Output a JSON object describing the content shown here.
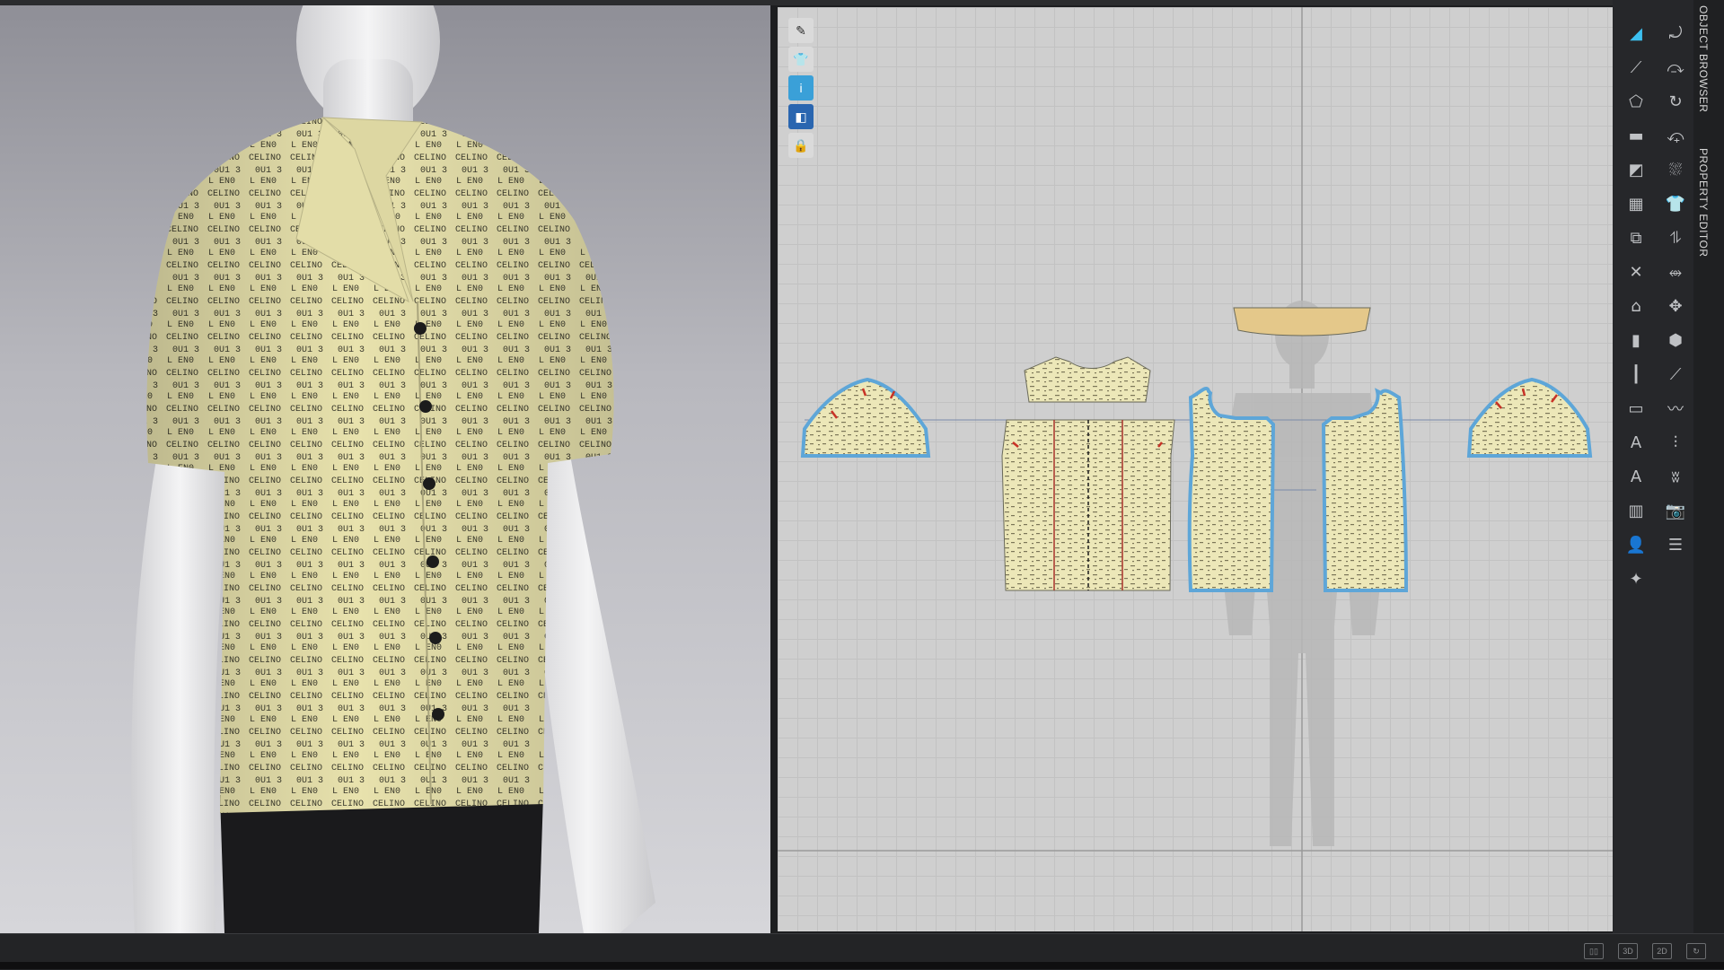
{
  "app": {
    "accent": "#3cc0f0",
    "fabric_color": "#e8e2ad",
    "print_text": "CELINO"
  },
  "toolbox_2d": [
    {
      "name": "edit-pattern-icon",
      "glyph": "✎",
      "state": "normal"
    },
    {
      "name": "shirt-view-icon",
      "glyph": "👕",
      "state": "normal"
    },
    {
      "name": "info-icon",
      "glyph": "i",
      "state": "active"
    },
    {
      "name": "fabric-icon",
      "glyph": "◧",
      "state": "blue"
    },
    {
      "name": "lock-garment-icon",
      "glyph": "🔒",
      "state": "normal"
    }
  ],
  "right_toolbar": [
    {
      "name": "select-move-icon",
      "glyph": "◢",
      "selected": true
    },
    {
      "name": "transform-pattern-icon",
      "glyph": "⤾"
    },
    {
      "name": "edit-point-icon",
      "glyph": "⟋"
    },
    {
      "name": "edit-curvature-icon",
      "glyph": "⤼"
    },
    {
      "name": "polygon-icon",
      "glyph": "⬠"
    },
    {
      "name": "rotate-icon",
      "glyph": "↻"
    },
    {
      "name": "rectangle-icon",
      "glyph": "▬"
    },
    {
      "name": "sewing-icon",
      "glyph": "⤽"
    },
    {
      "name": "internal-shape-icon",
      "glyph": "◩"
    },
    {
      "name": "fold-arrangement-icon",
      "glyph": "⛆"
    },
    {
      "name": "texture-icon",
      "glyph": "▦"
    },
    {
      "name": "shirt-icon",
      "glyph": "👕"
    },
    {
      "name": "create-pattern-icon",
      "glyph": "⧉"
    },
    {
      "name": "segment-sewing-icon",
      "glyph": "⥮"
    },
    {
      "name": "cut-icon",
      "glyph": "✕"
    },
    {
      "name": "multi-sewing-icon",
      "glyph": "⥈"
    },
    {
      "name": "dart-icon",
      "glyph": "⌂"
    },
    {
      "name": "avatar-pin-icon",
      "glyph": "✥"
    },
    {
      "name": "pleat-icon",
      "glyph": "▮"
    },
    {
      "name": "button-icon",
      "glyph": "⬢"
    },
    {
      "name": "seamline-icon",
      "glyph": "┃"
    },
    {
      "name": "pen-icon",
      "glyph": "⟋"
    },
    {
      "name": "ruler-icon",
      "glyph": "▭"
    },
    {
      "name": "wave-icon",
      "glyph": "〰"
    },
    {
      "name": "annotation-icon",
      "glyph": "A"
    },
    {
      "name": "measure-icon",
      "glyph": "⫶"
    },
    {
      "name": "text-icon",
      "glyph": "A"
    },
    {
      "name": "topstitch-icon",
      "glyph": "ʬ"
    },
    {
      "name": "grade-icon",
      "glyph": "▥"
    },
    {
      "name": "snapshot-icon",
      "glyph": "📷"
    },
    {
      "name": "avatar-icon",
      "glyph": "👤"
    },
    {
      "name": "layers-icon",
      "glyph": "☰"
    },
    {
      "name": "tack-icon",
      "glyph": "✦"
    }
  ],
  "side_tabs": {
    "object_browser": "OBJECT BROWSER",
    "property_editor": "PROPERTY EDITOR"
  },
  "status_icons": [
    {
      "name": "split-view-icon",
      "label": "▯▯"
    },
    {
      "name": "view-3d-icon",
      "label": "3D"
    },
    {
      "name": "view-2d-icon",
      "label": "2D"
    },
    {
      "name": "refresh-icon",
      "label": "↻"
    }
  ]
}
